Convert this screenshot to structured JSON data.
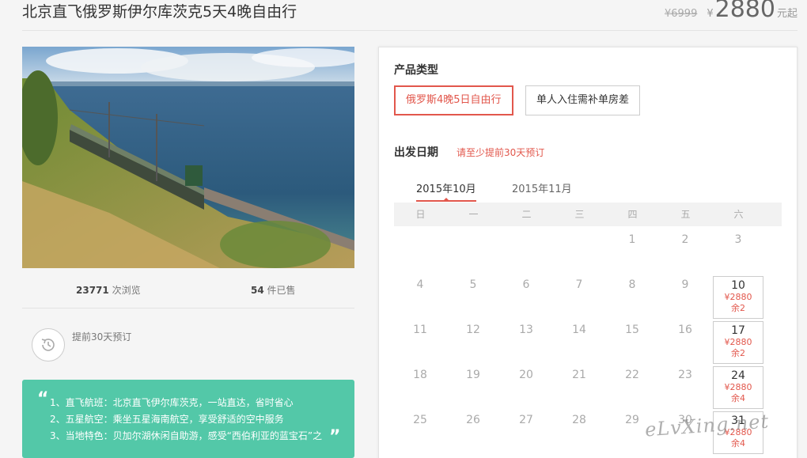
{
  "product": {
    "title": "北京直飞俄罗斯伊尔库茨克5天4晚自由行",
    "old_price": "¥6999",
    "currency": "¥",
    "price": "2880",
    "price_unit": "元起"
  },
  "stats": {
    "views": "23771",
    "views_label": "次浏览",
    "sold": "54",
    "sold_label": "件已售"
  },
  "booking_note": "提前30天预订",
  "features": [
    "1、直飞航班：北京直飞伊尔库茨克，一站直达，省时省心",
    "2、五星航空：乘坐五星海南航空，享受舒适的空中服务",
    "3、当地特色：贝加尔湖休闲自助游，感受“西伯利亚的蓝宝石”之"
  ],
  "panel": {
    "type_label": "产品类型",
    "types": [
      "俄罗斯4晚5日自由行",
      "单人入住需补单房差"
    ],
    "date_label": "出发日期",
    "date_hint": "请至少提前30天预订",
    "months": [
      "2015年10月",
      "2015年11月"
    ],
    "weekdays": [
      "日",
      "一",
      "二",
      "三",
      "四",
      "五",
      "六"
    ],
    "weeks": [
      [
        {
          "day": ""
        },
        {
          "day": ""
        },
        {
          "day": ""
        },
        {
          "day": ""
        },
        {
          "day": "1"
        },
        {
          "day": "2"
        },
        {
          "day": "3"
        }
      ],
      [
        {
          "day": "4"
        },
        {
          "day": "5"
        },
        {
          "day": "6"
        },
        {
          "day": "7"
        },
        {
          "day": "8"
        },
        {
          "day": "9"
        },
        {
          "day": "10",
          "price": "¥2880",
          "stock": "余2"
        }
      ],
      [
        {
          "day": "11"
        },
        {
          "day": "12"
        },
        {
          "day": "13"
        },
        {
          "day": "14"
        },
        {
          "day": "15"
        },
        {
          "day": "16"
        },
        {
          "day": "17",
          "price": "¥2880",
          "stock": "余2"
        }
      ],
      [
        {
          "day": "18"
        },
        {
          "day": "19"
        },
        {
          "day": "20"
        },
        {
          "day": "21"
        },
        {
          "day": "22"
        },
        {
          "day": "23"
        },
        {
          "day": "24",
          "price": "¥2880",
          "stock": "余4"
        }
      ],
      [
        {
          "day": "25"
        },
        {
          "day": "26"
        },
        {
          "day": "27"
        },
        {
          "day": "28"
        },
        {
          "day": "29"
        },
        {
          "day": "30"
        },
        {
          "day": "31",
          "price": "¥2880",
          "stock": "余4"
        }
      ]
    ]
  },
  "watermark": "eLvXing.net",
  "colors": {
    "accent": "#e2574c",
    "feature_bg": "#53c8a8"
  },
  "icons": {
    "booking": "clock-icon"
  }
}
